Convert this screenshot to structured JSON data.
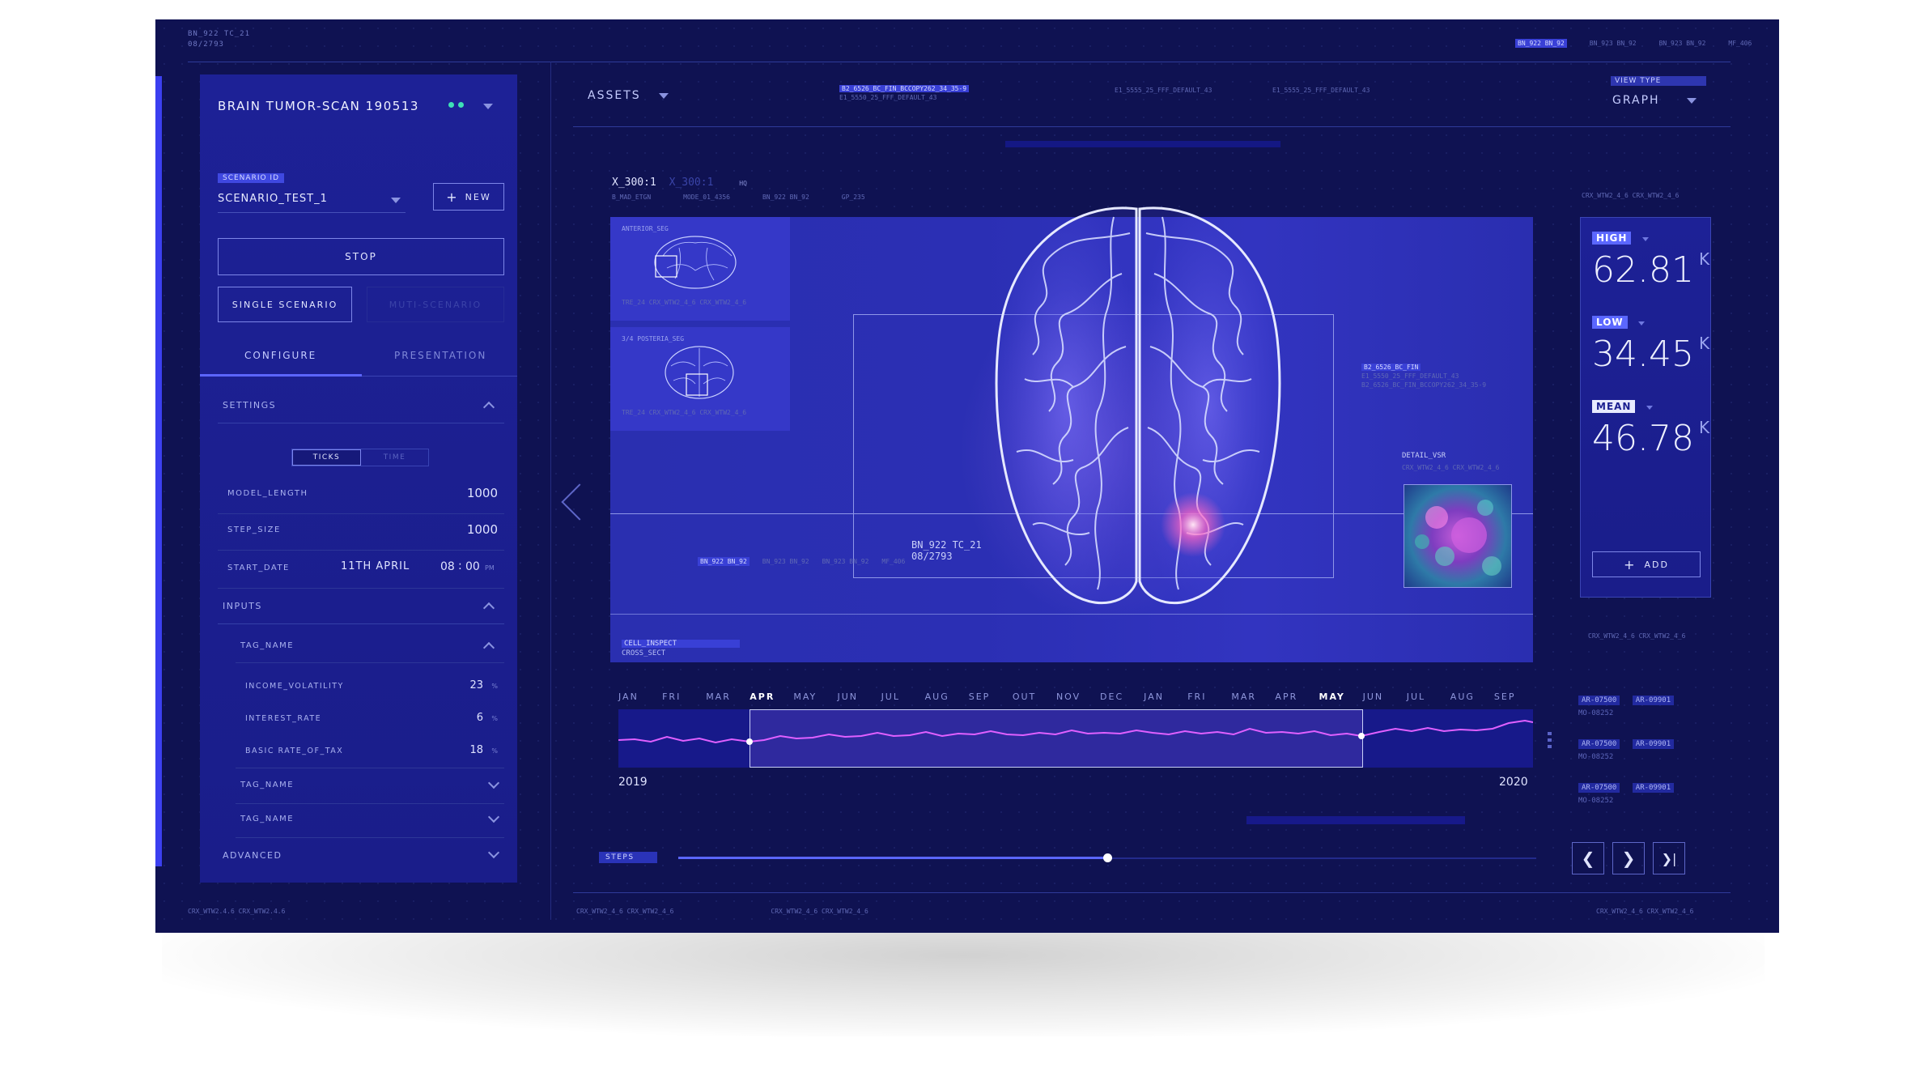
{
  "top_id": {
    "line1": "BN_922 TC_21",
    "line2": "08/2793"
  },
  "top_right_tags": [
    "BN_922 BN_92",
    "BN_923 BN_92",
    "BN_923 BN_92",
    "MF_406"
  ],
  "sidebar": {
    "title": "BRAIN TUMOR-SCAN 190513",
    "scenario_id_label": "SCENARIO ID",
    "scenario_value": "SCENARIO_TEST_1",
    "new_label": "NEW",
    "stop_label": "STOP",
    "single_label": "SINGLE SCENARIO",
    "multi_label": "MUTI-SCENARIO",
    "tabs": [
      "CONFIGURE",
      "PRESENTATION"
    ],
    "settings_label": "SETTINGS",
    "toggle": [
      "TICKS",
      "TIME"
    ],
    "fields": [
      {
        "label": "MODEL_LENGTH",
        "value": "1000"
      },
      {
        "label": "STEP_SIZE",
        "value": "1000"
      }
    ],
    "start_date_label": "START_DATE",
    "start_date_value": "11TH APRIL",
    "start_time_h": "08",
    "start_time_m": "00",
    "start_time_ampm": "PM",
    "inputs_label": "INPUTS",
    "tag_name_label": "TAG_NAME",
    "input_rows": [
      {
        "label": "INCOME_VOLATILITY",
        "value": "23",
        "unit": "%"
      },
      {
        "label": "INTEREST_RATE",
        "value": "6",
        "unit": "%"
      },
      {
        "label": "BASIC RATE_OF_TAX",
        "value": "18",
        "unit": "%"
      }
    ],
    "tag_name_2": "TAG_NAME",
    "tag_name_3": "TAG_NAME",
    "advanced_label": "ADVANCED",
    "footer": "CRX_WTW2.4.6 CRX_WTW2.4.6"
  },
  "header": {
    "assets_label": "ASSETS",
    "code1": "B2_6526_BC_FIN_BCCOPY262_34_35-9",
    "code2": "E1_5550_25_FFF_DEFAULT_43",
    "code3": "E1_5555_25_FFF_DEFAULT_43",
    "code4": "E1_5555_25_FFF_DEFAULT_43",
    "view_type_label": "VIEW TYPE",
    "view_type_value": "GRAPH"
  },
  "viewer": {
    "coord": "X_300:1",
    "coord_ghost": "X_300:1",
    "hq": "HQ",
    "meta": [
      "B_MAD_ETGN",
      "MODE_01_4356",
      "BN_922 BN_92",
      "GP_235"
    ],
    "thumb1_label": "ANTERIOR_SEG",
    "thumb2_label": "3/4 POSTERIA_SEG",
    "thumb_meta": "TRE_24 CRX_WTW2_4_6 CRX_WTW2_4_6",
    "center_id1": "BN_922 TC_21",
    "center_id2": "08/2793",
    "bottom_tags": [
      "BN_922 BN_92",
      "BN_923 BN_92",
      "BN_923 BN_92",
      "MF_406"
    ],
    "right_codes": [
      "B2_6526_BC_FIN",
      "E1_5550_25_FFF_DEFAULT_43",
      "B2_6526_BC_FIN_BCCOPY262_34_35-9"
    ],
    "detail_label": "DETAIL_VSR",
    "detail_meta": "CRX_WTW2_4_6 CRX_WTW2_4_6",
    "cell_inspect": "CELL_INSPECT",
    "cross_sect": "CROSS_SECT"
  },
  "stats": {
    "top_meta": "CRX_WTW2_4_6 CRX_WTW2_4_6",
    "items": [
      {
        "tag": "HIGH",
        "value": "62.81",
        "unit": "K"
      },
      {
        "tag": "LOW",
        "value": "34.45",
        "unit": "K"
      },
      {
        "tag": "MEAN",
        "value": "46.78",
        "unit": "K"
      }
    ],
    "add_label": "ADD",
    "id_rows": [
      {
        "a": "AR-07500",
        "b": "AR-09901",
        "c": "MO-08252"
      },
      {
        "a": "AR-07500",
        "b": "AR-09901",
        "c": "MO-08252"
      },
      {
        "a": "AR-07500",
        "b": "AR-09901",
        "c": "MO-08252"
      }
    ]
  },
  "timeline": {
    "months": [
      "JAN",
      "FRI",
      "MAR",
      "APR",
      "MAY",
      "JUN",
      "JUL",
      "AUG",
      "SEP",
      "OUT",
      "NOV",
      "DEC",
      "JAN",
      "FRI",
      "MAR",
      "APR",
      "MAY",
      "JUN",
      "JUL",
      "AUG",
      "SEP"
    ],
    "active": [
      3,
      16
    ],
    "year_start": "2019",
    "year_end": "2020",
    "steps_label": "STEPS",
    "steps_progress": 0.5
  },
  "nav": {
    "prev": "❮",
    "next": "❯",
    "last": "❯|"
  },
  "footer_codes": "CRX_WTW2_4_6 CRX_WTW2_4_6"
}
